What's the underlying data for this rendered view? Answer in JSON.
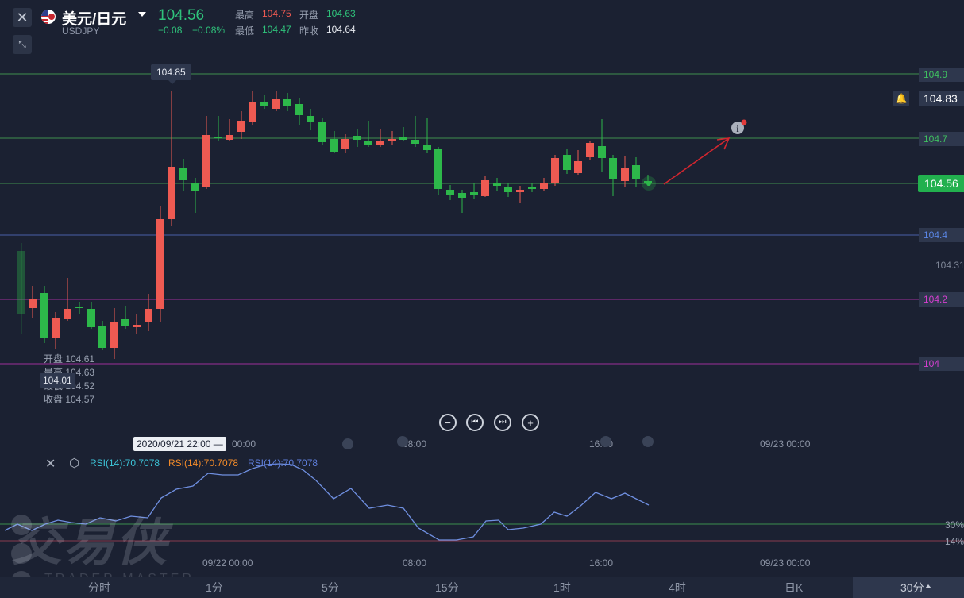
{
  "header": {
    "pair_name": "美元/日元",
    "pair_code": "USDJPY",
    "price": "104.56",
    "change": "−0.08",
    "change_pct": "−0.08%",
    "high_label": "最高",
    "high_value": "104.75",
    "open_label": "开盘",
    "open_value": "104.63",
    "low_label": "最低",
    "low_value": "104.47",
    "prevclose_label": "昨收",
    "prevclose_value": "104.64"
  },
  "chart": {
    "peak_label": "104.85",
    "low_label": "104.01",
    "price_tags": {
      "top_green": "104.9",
      "alert": "104.83",
      "upper_green": "104.7",
      "current": "104.56",
      "blue": "104.4",
      "gray": "104.31",
      "magenta1": "104.2",
      "magenta2": "104"
    },
    "ohlc": {
      "open": "开盘 104.61",
      "high": "最高 104.63",
      "low": "最低 104.52",
      "close": "收盘 104.57"
    },
    "crosshair_time": "2020/09/21 22:00 —",
    "time_labels": [
      "00:00",
      "08:00",
      "16:00",
      "09/23 00:00"
    ],
    "rsi_labels": [
      "RSI(14):70.7078",
      "RSI(14):70.7078",
      "RSI(14):70.7078"
    ],
    "rsi_levels": [
      "30%",
      "14%"
    ],
    "bottom_time_labels": [
      "09/22 00:00",
      "08:00",
      "16:00",
      "09/23 00:00"
    ],
    "colors": {
      "up": "#ee5a52",
      "down": "#2db84a",
      "bg": "#1b2132"
    }
  },
  "watermark": {
    "cn": "交易侠",
    "en": "TRADER MASTER"
  },
  "tabs": [
    "分时",
    "1分",
    "5分",
    "15分",
    "1时",
    "4时",
    "日K",
    "30分"
  ]
}
